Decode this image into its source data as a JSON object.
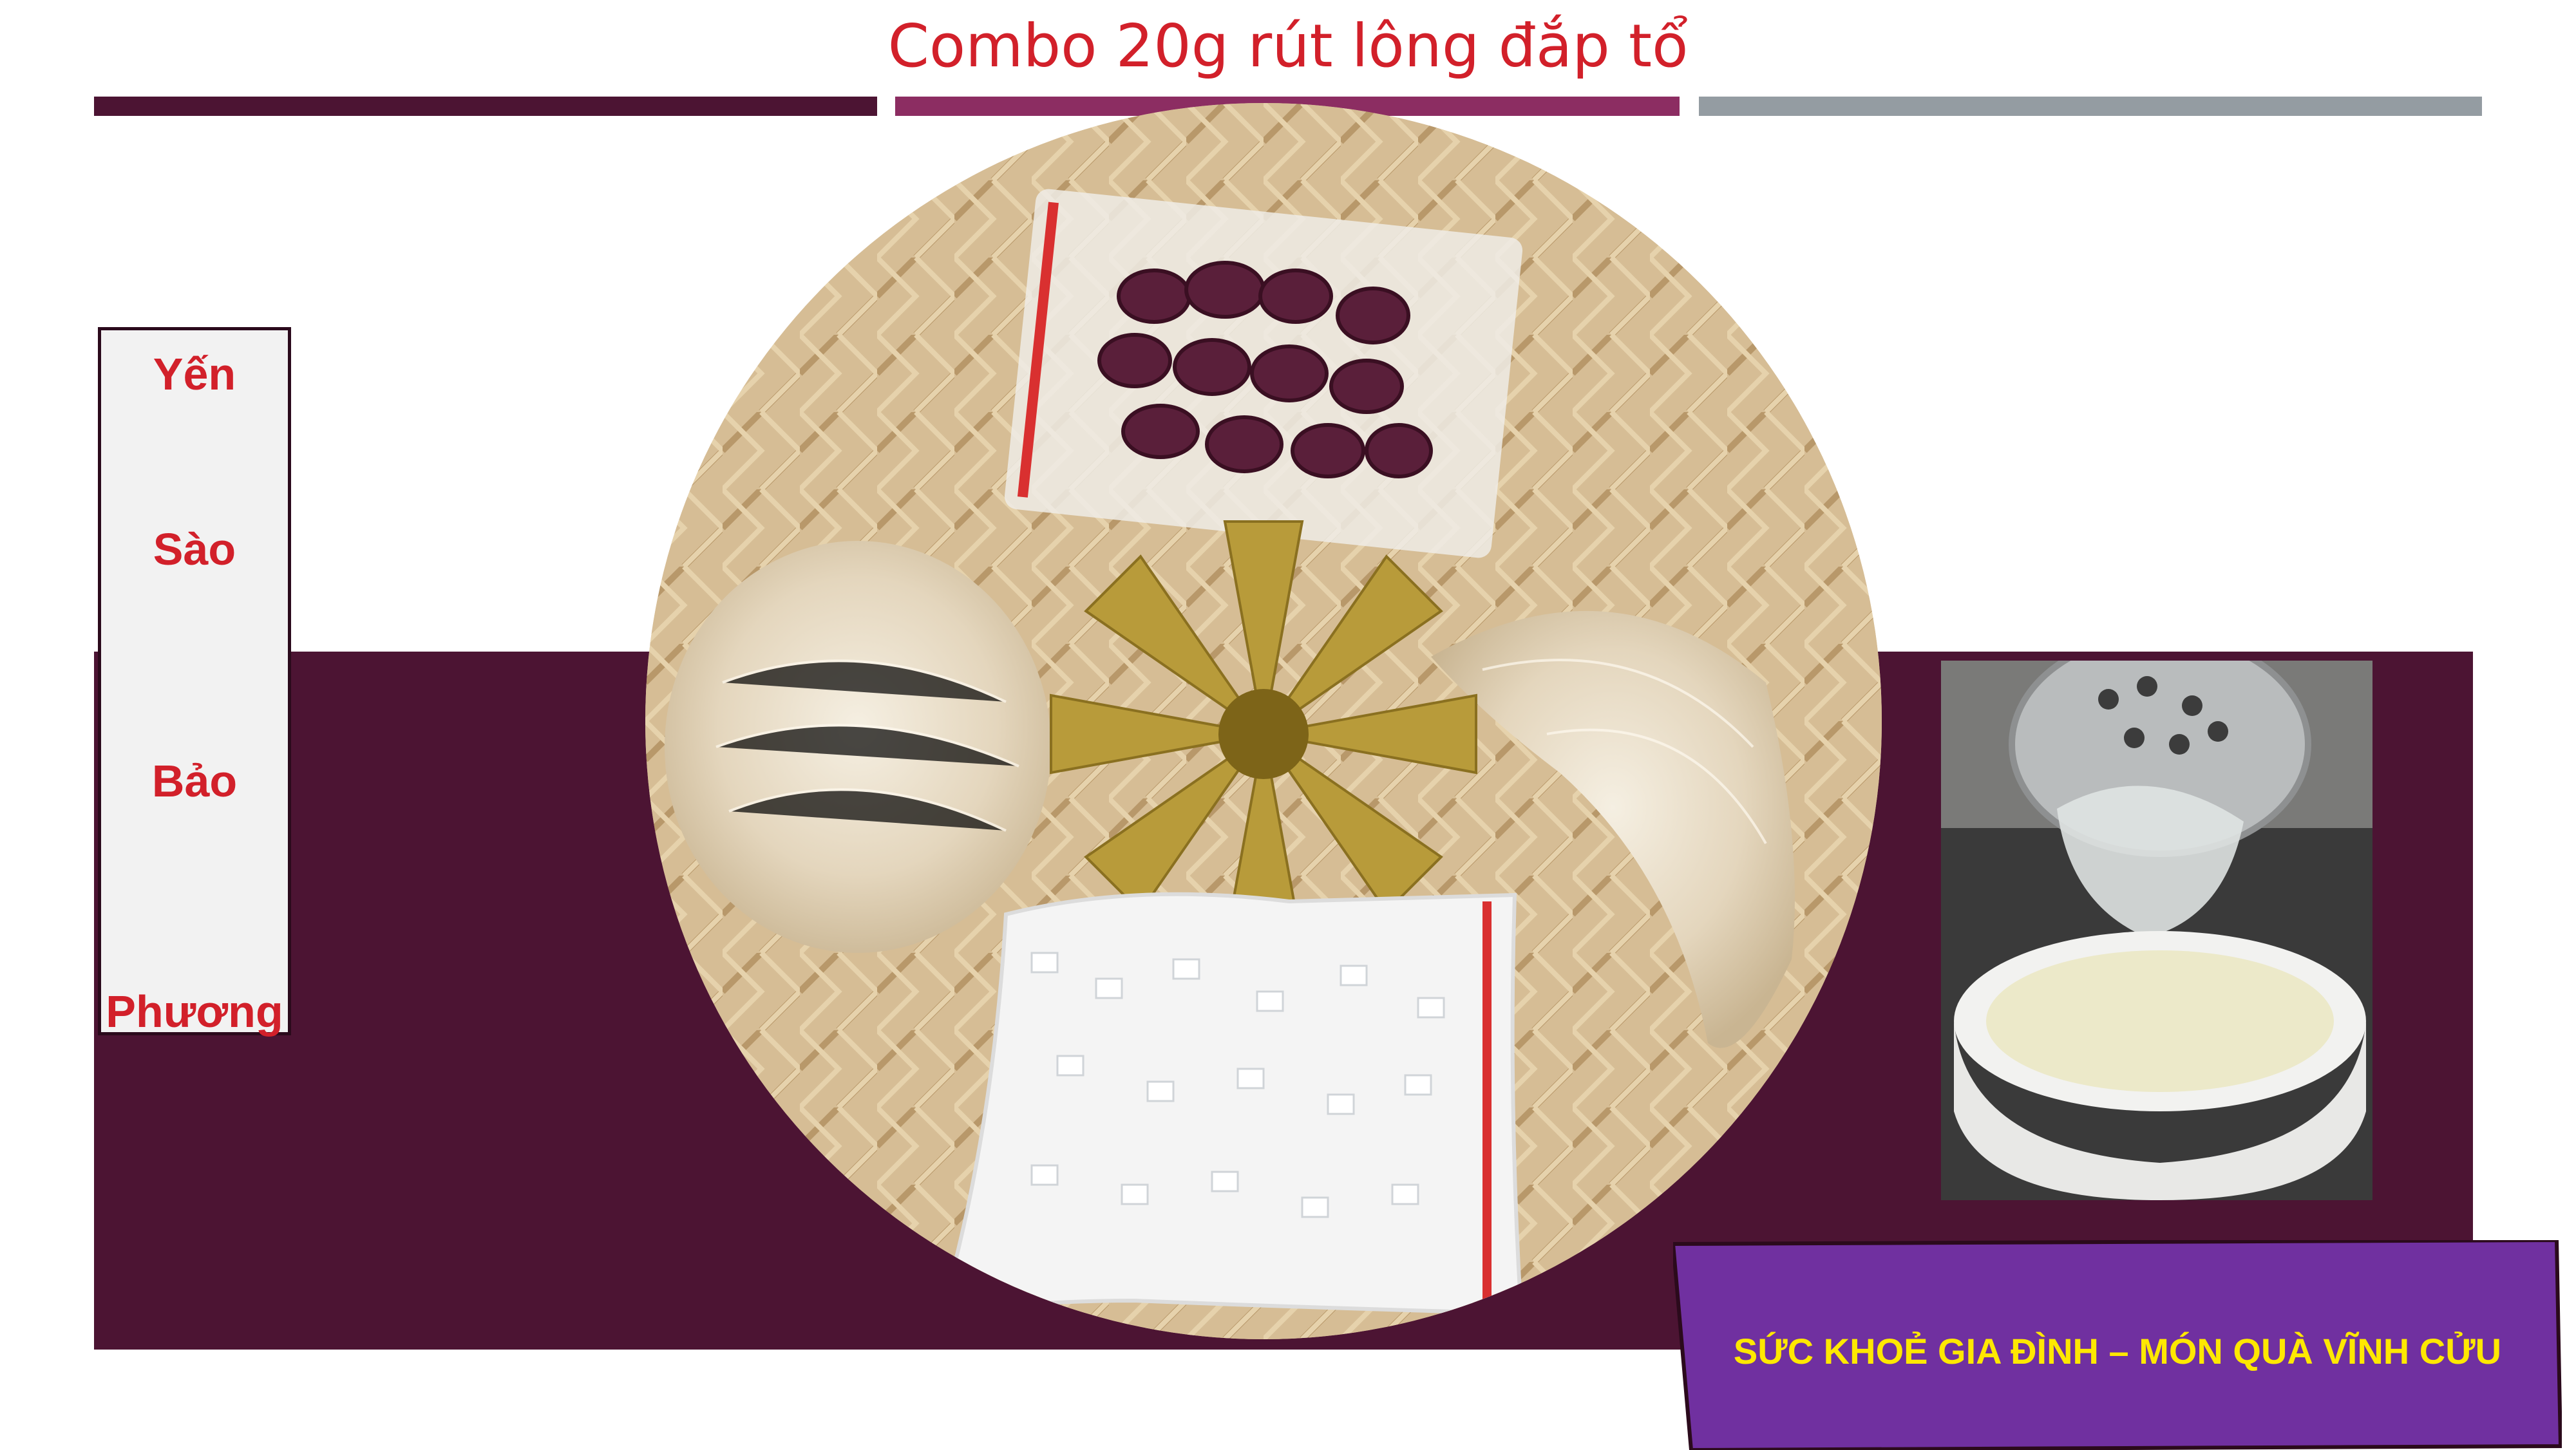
{
  "slide": {
    "title": "Combo 20g rút lông đắp tổ",
    "brand_words": [
      "Yến",
      "Sào",
      "Bảo",
      "Phương"
    ],
    "slogan": "SỨC KHOẺ GIA ĐÌNH – MÓN QUÀ VĨNH CỬU"
  },
  "colors": {
    "title_red": "#d2202a",
    "plum": "#4c1433",
    "magenta": "#8c2d62",
    "gray": "#949ca2",
    "slogan_bg": "#7030a0",
    "slogan_text": "#ffe800"
  },
  "images": {
    "main_photo": "product-photo-bird-nests-jujube-rock-sugar-flower",
    "side_photo": "bird-nest-soup-ladle-photo"
  }
}
